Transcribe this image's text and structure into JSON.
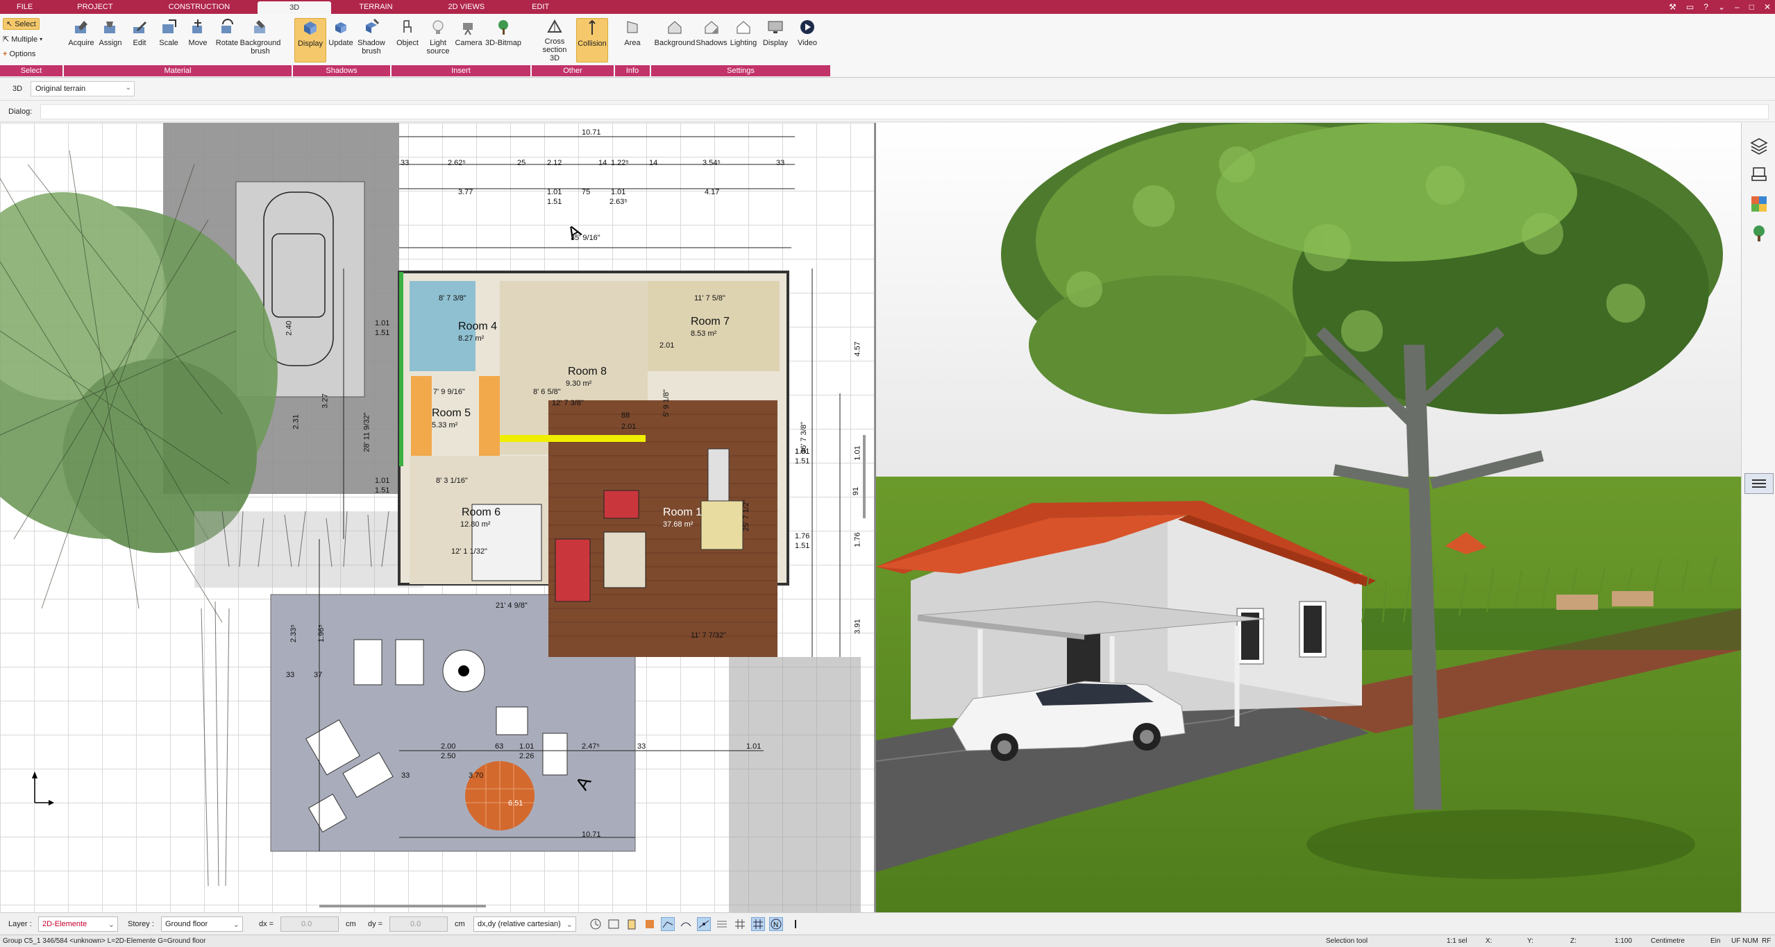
{
  "menu": {
    "tabs": [
      "FILE",
      "PROJECT",
      "CONSTRUCTION",
      "3D",
      "TERRAIN",
      "2D VIEWS",
      "EDIT"
    ],
    "active": "3D"
  },
  "ribbon": {
    "select_group": {
      "select": "Select",
      "multiple": "Multiple",
      "options": "Options",
      "label": "Select"
    },
    "material_group": {
      "acquire": "Acquire",
      "assign": "Assign",
      "edit": "Edit",
      "scale": "Scale",
      "move": "Move",
      "rotate": "Rotate",
      "background_brush": "Background brush",
      "label": "Material"
    },
    "shadows_group": {
      "display": "Display",
      "update": "Update",
      "shadow_brush": "Shadow brush",
      "label": "Shadows"
    },
    "insert_group": {
      "object": "Object",
      "light_source": "Light source",
      "camera": "Camera",
      "bitmap": "3D-Bitmap",
      "label": "Insert"
    },
    "other_group": {
      "cross_section": "Cross section 3D",
      "collision": "Collision",
      "label": "Other"
    },
    "info_group": {
      "area": "Area",
      "label": "Info"
    },
    "settings_group": {
      "background": "Background",
      "shadows": "Shadows",
      "lighting": "Lighting",
      "display": "Display",
      "video": "Video",
      "label": "Settings"
    }
  },
  "viewbar": {
    "mode": "3D",
    "terrain": "Original terrain"
  },
  "dialog": {
    "label": "Dialog:"
  },
  "plan": {
    "top_dims": {
      "total": "10.71",
      "row1": [
        "33",
        "2.62⁵",
        "25",
        "2.12",
        "14",
        "1.22⁵",
        "14",
        "3.54⁵",
        "33"
      ],
      "row2": [
        "3.77",
        "1.01",
        "1.51",
        "75",
        "1.01",
        "2.63⁵",
        "4.17"
      ]
    },
    "rooms": [
      {
        "name": "Room 4",
        "area": "8.27 m²"
      },
      {
        "name": "Room 7",
        "area": "8.53 m²"
      },
      {
        "name": "Room 8",
        "area": "9.30 m²"
      },
      {
        "name": "Room 5",
        "area": "5.33 m²"
      },
      {
        "name": "Room 6",
        "area": "12.80 m²"
      },
      {
        "name": "Room 1",
        "area": "37.68 m²"
      }
    ],
    "side_dims": [
      "4.57",
      "1.01",
      "91",
      "1.76",
      "3.91",
      "1.01",
      "1.51",
      "1.76",
      "1.51"
    ],
    "left_dims": [
      "2.40",
      "3.27",
      "2.31",
      "1.01",
      "1.51",
      "28' 11 9/32\"",
      "1.01",
      "1.51"
    ],
    "terrace_dims": [
      "2.00",
      "2.50",
      "63",
      "1.01",
      "2.26",
      "2.47⁵",
      "33",
      "33",
      "1.01",
      "3.70",
      "6.51",
      "10.71",
      "2.33⁵",
      "1.96⁵",
      "33",
      "37",
      "21' 4 9/8\"",
      "11' 7 7/32\"",
      "35' 9/16\""
    ],
    "imperial_labels": [
      "8' 7 3/8\"",
      "11' 7 5/8\"",
      "7' 9 9/16\"",
      "8' 6 5/8\"",
      "12' 7 3/8\"",
      "8' 3 1/16\"",
      "12' 1 1/32\"",
      "36' 7 3/8\"",
      "5' 9 1/8\"",
      "25' 7 1/2\"",
      "2.01",
      "2.01",
      "88",
      "1.51"
    ]
  },
  "bottom": {
    "layer_label": "Layer :",
    "layer_value": "2D-Elemente",
    "storey_label": "Storey :",
    "storey_value": "Ground floor",
    "dx_label": "dx =",
    "dx_value": "0.0",
    "dx_unit": "cm",
    "dy_label": "dy =",
    "dy_value": "0.0",
    "dy_unit": "cm",
    "coord_mode": "dx,dy (relative cartesian)"
  },
  "status": {
    "group": "Group C5_1 346/584 <unknown> L=2D-Elemente G=Ground floor",
    "tool": "Selection tool",
    "x": "X:",
    "y": "Y:",
    "z": "Z:",
    "scale": "1:100",
    "unit": "Centimetre",
    "ein": "Ein",
    "uf": "UF",
    "num": "NUM",
    "rf": "RF",
    "sel": "1:1 sel"
  },
  "colors": {
    "accent": "#b0254a",
    "group": "#c2336a",
    "active_btn": "#f5c96b"
  }
}
